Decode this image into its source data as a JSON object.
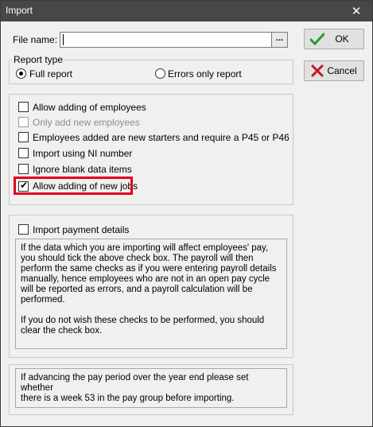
{
  "window": {
    "title": "Import",
    "close_glyph": "✕"
  },
  "file": {
    "label": "File name:",
    "value": "",
    "browse_label": "..."
  },
  "buttons": {
    "ok_label": "OK",
    "cancel_label": "Cancel"
  },
  "report_type": {
    "title": "Report type",
    "full": "Full report",
    "errors": "Errors only report",
    "selected": "full"
  },
  "options": [
    {
      "label": "Allow adding of employees",
      "checked": false,
      "enabled": true
    },
    {
      "label": "Only add new employees",
      "checked": false,
      "enabled": false
    },
    {
      "label": "Employees added are new starters and require a P45 or P46",
      "checked": false,
      "enabled": true
    },
    {
      "label": "Import using NI number",
      "checked": false,
      "enabled": true
    },
    {
      "label": "Ignore blank data items",
      "checked": false,
      "enabled": true
    },
    {
      "label": "Allow adding of new jobs",
      "checked": true,
      "enabled": true
    }
  ],
  "payment": {
    "label": "Import payment details",
    "checked": false,
    "info": "If the data which you are importing will affect employees' pay,\nyou should tick the above check box. The payroll will then\nperform the same checks as if you were entering payroll details\nmanually, hence employees who are not in an open pay cycle\nwill be reported as errors, and a payroll calculation will be\nperformed.\n\nIf you do not wish these checks to be performed, you should\nclear the check box."
  },
  "year_end_note": "If advancing the pay period over the year end please set whether\nthere is a week 53 in the pay group before importing.",
  "colors": {
    "titlebar": "#474747",
    "highlight": "#e0001a",
    "ok_check": "#2a9a2a",
    "cancel_x": "#c0182a"
  }
}
